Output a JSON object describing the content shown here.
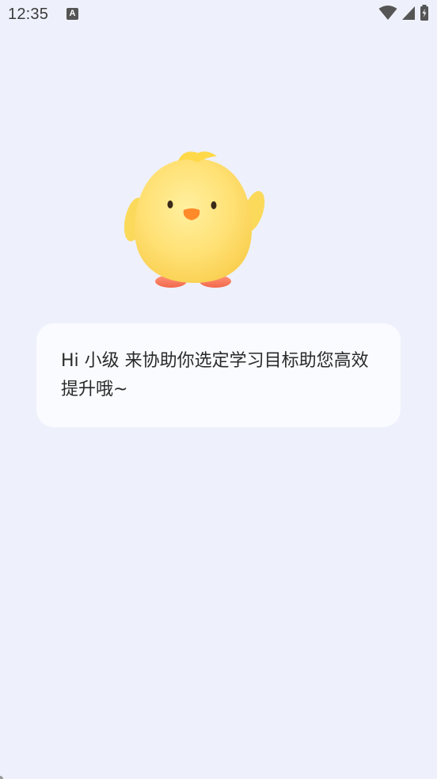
{
  "status_bar": {
    "time": "12:35",
    "notification_icon": "A",
    "icons": [
      "wifi-icon",
      "signal-icon",
      "battery-icon"
    ]
  },
  "mascot": {
    "icon": "chick-mascot"
  },
  "bubble": {
    "text": "Hi 小级 来协助你选定学习目标助您高效提升哦~"
  },
  "colors": {
    "background": "#eef1fb",
    "bubble": "#fafbff",
    "text": "#2a2a2a",
    "chick_body": "#ffe073",
    "chick_beak": "#ff8a2a",
    "chick_feet": "#ff7b5a"
  }
}
